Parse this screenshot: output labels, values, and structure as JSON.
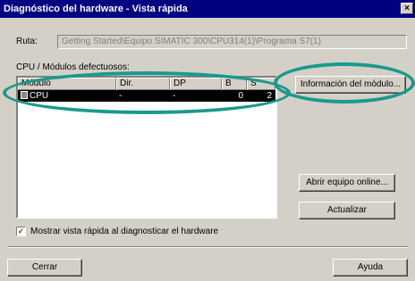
{
  "window": {
    "title": "Diagnóstico del hardware - Vista rápida",
    "close_glyph": "×"
  },
  "path": {
    "label": "Ruta:",
    "value": "Getting Started\\Equipo SIMATIC 300\\CPU314(1)\\Programa S7(1)"
  },
  "modules": {
    "label": "CPU / Módulos defectuosos:",
    "columns": [
      "Módulo",
      "Dir.",
      "DP",
      "B",
      "S"
    ],
    "rows": [
      {
        "icon": "cpu-icon",
        "module": "CPU",
        "dir": "-",
        "dp": "-",
        "b": "0",
        "s": "2"
      }
    ]
  },
  "buttons": {
    "module_info": "Información del módulo...",
    "open_online": "Abrir equipo online...",
    "update": "Actualizar",
    "close": "Cerrar",
    "help": "Ayuda"
  },
  "options": {
    "show_quick_view": "Mostrar vista rápida al diagnosticar el hardware",
    "show_quick_view_checked": true
  },
  "colors": {
    "titlebar": "#000080",
    "face": "#d4d0c8",
    "highlight_ellipse": "#199a8c"
  }
}
